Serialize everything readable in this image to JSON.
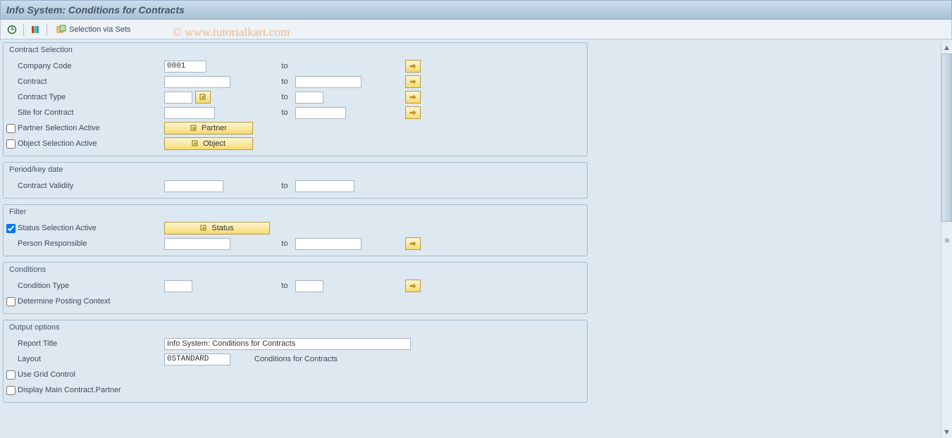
{
  "header": {
    "title": "Info System: Conditions for Contracts"
  },
  "toolbar": {
    "selection_via_sets": "Selection via Sets"
  },
  "watermark": "© www.tutorialkart.com",
  "groups": {
    "contract_selection": {
      "title": "Contract Selection",
      "fields": {
        "company_code": {
          "label": "Company Code",
          "from": "0001",
          "to_label": "to",
          "to": ""
        },
        "contract": {
          "label": "Contract",
          "from": "",
          "to_label": "to",
          "to": ""
        },
        "contract_type": {
          "label": "Contract Type",
          "from": "",
          "to_label": "to",
          "to": ""
        },
        "site_for_contract": {
          "label": "Site for Contract",
          "from": "",
          "to_label": "to",
          "to": ""
        },
        "partner_selection_active": {
          "label": "Partner Selection Active",
          "checked": false,
          "button": "Partner"
        },
        "object_selection_active": {
          "label": "Object Selection Active",
          "checked": false,
          "button": "Object"
        }
      }
    },
    "period": {
      "title": "Period/key date",
      "fields": {
        "contract_validity": {
          "label": "Contract Validity",
          "from": "",
          "to_label": "to",
          "to": ""
        }
      }
    },
    "filter": {
      "title": "Filter",
      "fields": {
        "status_selection_active": {
          "label": "Status Selection Active",
          "checked": true,
          "button": "Status"
        },
        "person_responsible": {
          "label": "Person Responsible",
          "from": "",
          "to_label": "to",
          "to": ""
        }
      }
    },
    "conditions": {
      "title": "Conditions",
      "fields": {
        "condition_type": {
          "label": "Condition Type",
          "from": "",
          "to_label": "to",
          "to": ""
        },
        "determine_posting_context": {
          "label": "Determine Posting Context",
          "checked": false
        }
      }
    },
    "output": {
      "title": "Output options",
      "fields": {
        "report_title": {
          "label": "Report Title",
          "value": "Info System: Conditions for Contracts"
        },
        "layout": {
          "label": "Layout",
          "value": "0STANDARD",
          "desc": "Conditions for Contracts"
        },
        "use_grid_control": {
          "label": "Use Grid Control",
          "checked": false
        },
        "display_main_contract_partner": {
          "label": "Display Main Contract.Partner",
          "checked": false
        }
      }
    }
  }
}
